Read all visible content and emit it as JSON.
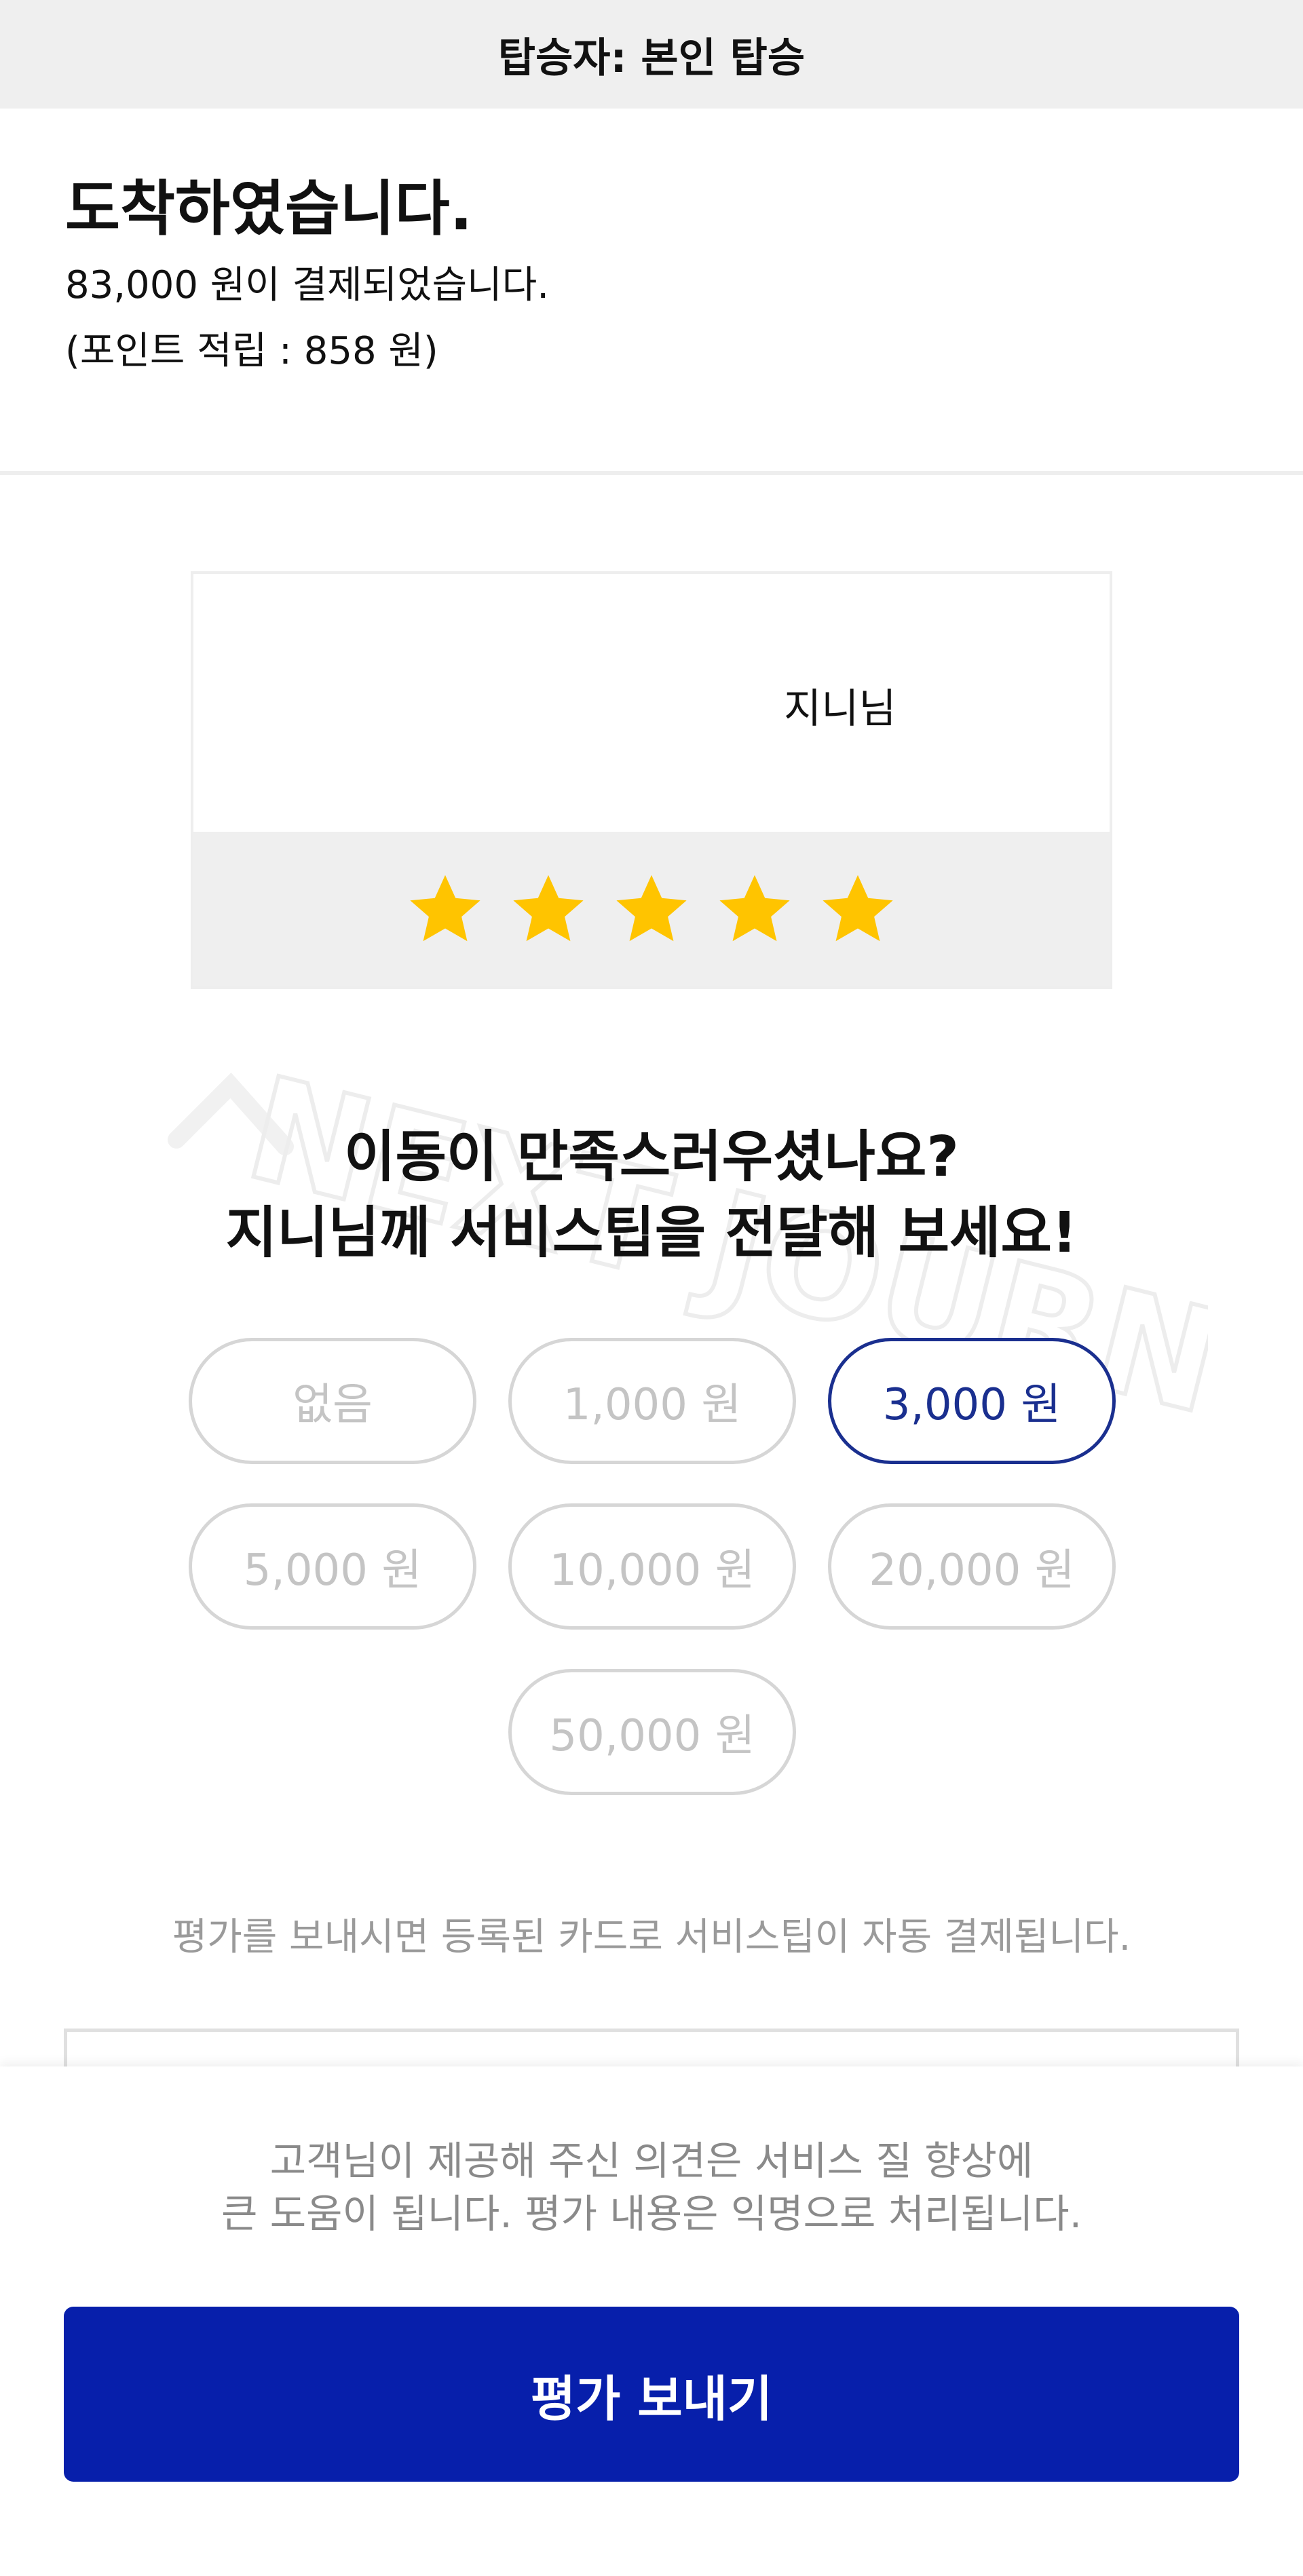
{
  "header": {
    "passenger": "탑승자: 본인 탑승"
  },
  "arrival": {
    "title": "도착하였습니다.",
    "payment": "83,000 원이 결제되었습니다.",
    "points": "(포인트 적립 : 858 원)"
  },
  "driver": {
    "name": "지니님",
    "rating": 5,
    "max_rating": 5,
    "star_color": "#ffc400"
  },
  "tip": {
    "question_line1": "이동이 만족스러우셨나요?",
    "question_line2": "지니님께 서비스팁을 전달해 보세요!",
    "options": [
      "없음",
      "1,000 원",
      "3,000 원",
      "5,000 원",
      "10,000 원",
      "20,000 원",
      "50,000 원"
    ],
    "selected": "3,000 원",
    "notice": "평가를 보내시면 등록된 카드로 서비스팁이 자동 결제됩니다."
  },
  "footer": {
    "info_line1": "고객님이 제공해 주신 의견은 서비스 질 향상에",
    "info_line2": "큰 도움이 됩니다. 평가 내용은 익명으로 처리됩니다.",
    "submit_label": "평가 보내기"
  },
  "colors": {
    "accent": "#071fab",
    "selected_tip": "#1a2f8f",
    "star": "#ffc400"
  },
  "watermark": {
    "text": "NEXT JOURNEY"
  }
}
